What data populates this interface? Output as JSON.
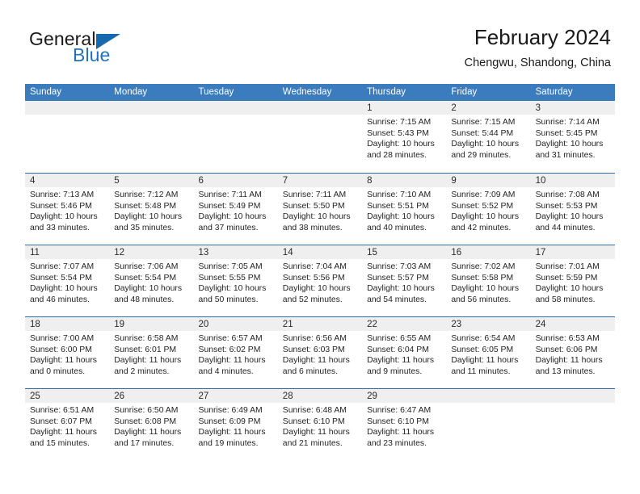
{
  "logo": {
    "word_top": "General",
    "word_bottom": "Blue",
    "accent_color": "#1769ad"
  },
  "header": {
    "title": "February 2024",
    "location": "Chengwu, Shandong, China"
  },
  "theme": {
    "header_blue": "#3a7cbe",
    "row_divider_blue": "#2f6ca8",
    "day_band_gray": "#efefef"
  },
  "weekdays": [
    "Sunday",
    "Monday",
    "Tuesday",
    "Wednesday",
    "Thursday",
    "Friday",
    "Saturday"
  ],
  "weeks": [
    [
      {
        "day": "",
        "lines": []
      },
      {
        "day": "",
        "lines": []
      },
      {
        "day": "",
        "lines": []
      },
      {
        "day": "",
        "lines": []
      },
      {
        "day": "1",
        "lines": [
          "Sunrise: 7:15 AM",
          "Sunset: 5:43 PM",
          "Daylight: 10 hours",
          "and 28 minutes."
        ]
      },
      {
        "day": "2",
        "lines": [
          "Sunrise: 7:15 AM",
          "Sunset: 5:44 PM",
          "Daylight: 10 hours",
          "and 29 minutes."
        ]
      },
      {
        "day": "3",
        "lines": [
          "Sunrise: 7:14 AM",
          "Sunset: 5:45 PM",
          "Daylight: 10 hours",
          "and 31 minutes."
        ]
      }
    ],
    [
      {
        "day": "4",
        "lines": [
          "Sunrise: 7:13 AM",
          "Sunset: 5:46 PM",
          "Daylight: 10 hours",
          "and 33 minutes."
        ]
      },
      {
        "day": "5",
        "lines": [
          "Sunrise: 7:12 AM",
          "Sunset: 5:48 PM",
          "Daylight: 10 hours",
          "and 35 minutes."
        ]
      },
      {
        "day": "6",
        "lines": [
          "Sunrise: 7:11 AM",
          "Sunset: 5:49 PM",
          "Daylight: 10 hours",
          "and 37 minutes."
        ]
      },
      {
        "day": "7",
        "lines": [
          "Sunrise: 7:11 AM",
          "Sunset: 5:50 PM",
          "Daylight: 10 hours",
          "and 38 minutes."
        ]
      },
      {
        "day": "8",
        "lines": [
          "Sunrise: 7:10 AM",
          "Sunset: 5:51 PM",
          "Daylight: 10 hours",
          "and 40 minutes."
        ]
      },
      {
        "day": "9",
        "lines": [
          "Sunrise: 7:09 AM",
          "Sunset: 5:52 PM",
          "Daylight: 10 hours",
          "and 42 minutes."
        ]
      },
      {
        "day": "10",
        "lines": [
          "Sunrise: 7:08 AM",
          "Sunset: 5:53 PM",
          "Daylight: 10 hours",
          "and 44 minutes."
        ]
      }
    ],
    [
      {
        "day": "11",
        "lines": [
          "Sunrise: 7:07 AM",
          "Sunset: 5:54 PM",
          "Daylight: 10 hours",
          "and 46 minutes."
        ]
      },
      {
        "day": "12",
        "lines": [
          "Sunrise: 7:06 AM",
          "Sunset: 5:54 PM",
          "Daylight: 10 hours",
          "and 48 minutes."
        ]
      },
      {
        "day": "13",
        "lines": [
          "Sunrise: 7:05 AM",
          "Sunset: 5:55 PM",
          "Daylight: 10 hours",
          "and 50 minutes."
        ]
      },
      {
        "day": "14",
        "lines": [
          "Sunrise: 7:04 AM",
          "Sunset: 5:56 PM",
          "Daylight: 10 hours",
          "and 52 minutes."
        ]
      },
      {
        "day": "15",
        "lines": [
          "Sunrise: 7:03 AM",
          "Sunset: 5:57 PM",
          "Daylight: 10 hours",
          "and 54 minutes."
        ]
      },
      {
        "day": "16",
        "lines": [
          "Sunrise: 7:02 AM",
          "Sunset: 5:58 PM",
          "Daylight: 10 hours",
          "and 56 minutes."
        ]
      },
      {
        "day": "17",
        "lines": [
          "Sunrise: 7:01 AM",
          "Sunset: 5:59 PM",
          "Daylight: 10 hours",
          "and 58 minutes."
        ]
      }
    ],
    [
      {
        "day": "18",
        "lines": [
          "Sunrise: 7:00 AM",
          "Sunset: 6:00 PM",
          "Daylight: 11 hours",
          "and 0 minutes."
        ]
      },
      {
        "day": "19",
        "lines": [
          "Sunrise: 6:58 AM",
          "Sunset: 6:01 PM",
          "Daylight: 11 hours",
          "and 2 minutes."
        ]
      },
      {
        "day": "20",
        "lines": [
          "Sunrise: 6:57 AM",
          "Sunset: 6:02 PM",
          "Daylight: 11 hours",
          "and 4 minutes."
        ]
      },
      {
        "day": "21",
        "lines": [
          "Sunrise: 6:56 AM",
          "Sunset: 6:03 PM",
          "Daylight: 11 hours",
          "and 6 minutes."
        ]
      },
      {
        "day": "22",
        "lines": [
          "Sunrise: 6:55 AM",
          "Sunset: 6:04 PM",
          "Daylight: 11 hours",
          "and 9 minutes."
        ]
      },
      {
        "day": "23",
        "lines": [
          "Sunrise: 6:54 AM",
          "Sunset: 6:05 PM",
          "Daylight: 11 hours",
          "and 11 minutes."
        ]
      },
      {
        "day": "24",
        "lines": [
          "Sunrise: 6:53 AM",
          "Sunset: 6:06 PM",
          "Daylight: 11 hours",
          "and 13 minutes."
        ]
      }
    ],
    [
      {
        "day": "25",
        "lines": [
          "Sunrise: 6:51 AM",
          "Sunset: 6:07 PM",
          "Daylight: 11 hours",
          "and 15 minutes."
        ]
      },
      {
        "day": "26",
        "lines": [
          "Sunrise: 6:50 AM",
          "Sunset: 6:08 PM",
          "Daylight: 11 hours",
          "and 17 minutes."
        ]
      },
      {
        "day": "27",
        "lines": [
          "Sunrise: 6:49 AM",
          "Sunset: 6:09 PM",
          "Daylight: 11 hours",
          "and 19 minutes."
        ]
      },
      {
        "day": "28",
        "lines": [
          "Sunrise: 6:48 AM",
          "Sunset: 6:10 PM",
          "Daylight: 11 hours",
          "and 21 minutes."
        ]
      },
      {
        "day": "29",
        "lines": [
          "Sunrise: 6:47 AM",
          "Sunset: 6:10 PM",
          "Daylight: 11 hours",
          "and 23 minutes."
        ]
      },
      {
        "day": "",
        "lines": []
      },
      {
        "day": "",
        "lines": []
      }
    ]
  ]
}
